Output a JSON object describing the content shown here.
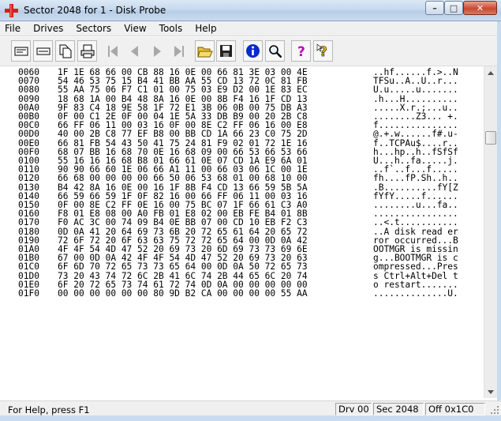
{
  "window": {
    "title": "Sector 2048 for 1 - Disk Probe"
  },
  "menu": [
    "File",
    "Drives",
    "Sectors",
    "View",
    "Tools",
    "Help"
  ],
  "toolbar": [
    {
      "name": "drive-icon",
      "enabled": true
    },
    {
      "name": "volume-icon",
      "enabled": true
    },
    {
      "name": "copy-icon",
      "enabled": true
    },
    {
      "name": "print-icon",
      "enabled": true
    },
    {
      "name": "first-sector-icon",
      "enabled": false
    },
    {
      "name": "previous-sector-icon",
      "enabled": false
    },
    {
      "name": "next-sector-icon",
      "enabled": false
    },
    {
      "name": "last-sector-icon",
      "enabled": false
    },
    {
      "name": "open-folder-icon",
      "enabled": true
    },
    {
      "name": "save-icon",
      "enabled": true
    },
    {
      "name": "info-icon",
      "enabled": true
    },
    {
      "name": "find-icon",
      "enabled": true
    },
    {
      "name": "help-icon",
      "enabled": true
    },
    {
      "name": "context-help-icon",
      "enabled": true
    }
  ],
  "hex": {
    "rows": [
      {
        "offset": "0060",
        "bytes": "1F 1E 68 66 00 CB 88 16 0E 00 66 81 3E 03 00 4E",
        "ascii": "..hf......f.>..N"
      },
      {
        "offset": "0070",
        "bytes": "54 46 53 75 15 B4 41 BB AA 55 CD 13 72 0C 81 FB",
        "ascii": "TFSu..A..U..r..."
      },
      {
        "offset": "0080",
        "bytes": "55 AA 75 06 F7 C1 01 00 75 03 E9 D2 00 1E 83 EC",
        "ascii": "U.u.....u......."
      },
      {
        "offset": "0090",
        "bytes": "18 68 1A 00 B4 48 8A 16 0E 00 8B F4 16 1F CD 13",
        "ascii": ".h...H.........."
      },
      {
        "offset": "00A0",
        "bytes": "9F 83 C4 18 9E 58 1F 72 E1 3B 06 0B 00 75 DB A3",
        "ascii": ".....X.r.;...u.."
      },
      {
        "offset": "00B0",
        "bytes": "0F 00 C1 2E 0F 00 04 1E 5A 33 DB B9 00 20 2B C8",
        "ascii": "........Z3... +."
      },
      {
        "offset": "00C0",
        "bytes": "66 FF 06 11 00 03 16 0F 00 8E C2 FF 06 16 00 E8",
        "ascii": "f..............."
      },
      {
        "offset": "00D0",
        "bytes": "40 00 2B C8 77 EF B8 00 BB CD 1A 66 23 C0 75 2D",
        "ascii": "@.+.w......f#.u-"
      },
      {
        "offset": "00E0",
        "bytes": "66 81 FB 54 43 50 41 75 24 81 F9 02 01 72 1E 16",
        "ascii": "f..TCPAu$....r.."
      },
      {
        "offset": "00F0",
        "bytes": "68 07 BB 16 68 70 0E 16 68 09 00 66 53 66 53 66",
        "ascii": "h...hp..h..fSfSf"
      },
      {
        "offset": "0100",
        "bytes": "55 16 16 16 68 B8 01 66 61 0E 07 CD 1A E9 6A 01",
        "ascii": "U...h..fa.....j."
      },
      {
        "offset": "0110",
        "bytes": "90 90 66 60 1E 06 66 A1 11 00 66 03 06 1C 00 1E",
        "ascii": "..f`..f...f....."
      },
      {
        "offset": "0120",
        "bytes": "66 68 00 00 00 00 66 50 06 53 68 01 00 68 10 00",
        "ascii": "fh....fP.Sh..h.."
      },
      {
        "offset": "0130",
        "bytes": "B4 42 8A 16 0E 00 16 1F 8B F4 CD 13 66 59 5B 5A",
        "ascii": ".B..........fY[Z"
      },
      {
        "offset": "0140",
        "bytes": "66 59 66 59 1F 0F 82 16 00 66 FF 06 11 00 03 16",
        "ascii": "fYfY.....f......"
      },
      {
        "offset": "0150",
        "bytes": "0F 00 8E C2 FF 0E 16 00 75 BC 07 1F 66 61 C3 A0",
        "ascii": "........u...fa.."
      },
      {
        "offset": "0160",
        "bytes": "F8 01 E8 08 00 A0 FB 01 E8 02 00 EB FE B4 01 8B",
        "ascii": "................"
      },
      {
        "offset": "0170",
        "bytes": "F0 AC 3C 00 74 09 B4 0E BB 07 00 CD 10 EB F2 C3",
        "ascii": "..<.t..........."
      },
      {
        "offset": "0180",
        "bytes": "0D 0A 41 20 64 69 73 6B 20 72 65 61 64 20 65 72",
        "ascii": "..A disk read er"
      },
      {
        "offset": "0190",
        "bytes": "72 6F 72 20 6F 63 63 75 72 72 65 64 00 0D 0A 42",
        "ascii": "ror occurred...B"
      },
      {
        "offset": "01A0",
        "bytes": "4F 4F 54 4D 47 52 20 69 73 20 6D 69 73 73 69 6E",
        "ascii": "OOTMGR is missin"
      },
      {
        "offset": "01B0",
        "bytes": "67 00 0D 0A 42 4F 4F 54 4D 47 52 20 69 73 20 63",
        "ascii": "g...BOOTMGR is c"
      },
      {
        "offset": "01C0",
        "bytes": "6F 6D 70 72 65 73 73 65 64 00 0D 0A 50 72 65 73",
        "ascii": "ompressed...Pres"
      },
      {
        "offset": "01D0",
        "bytes": "73 20 43 74 72 6C 2B 41 6C 74 2B 44 65 6C 20 74",
        "ascii": "s Ctrl+Alt+Del t"
      },
      {
        "offset": "01E0",
        "bytes": "6F 20 72 65 73 74 61 72 74 0D 0A 00 00 00 00 00",
        "ascii": "o restart......."
      },
      {
        "offset": "01F0",
        "bytes": "00 00 00 00 00 00 80 9D B2 CA 00 00 00 00 55 AA",
        "ascii": "..............U."
      }
    ]
  },
  "status": {
    "help": "For Help, press F1",
    "drive": "Drv  00",
    "sector": "Sec 2048",
    "offset": "Off 0x1C0"
  },
  "colors": {
    "titlebar": "#c6d9ee",
    "menubar": "#f0f0f0",
    "app_icon": "#d8201a"
  }
}
